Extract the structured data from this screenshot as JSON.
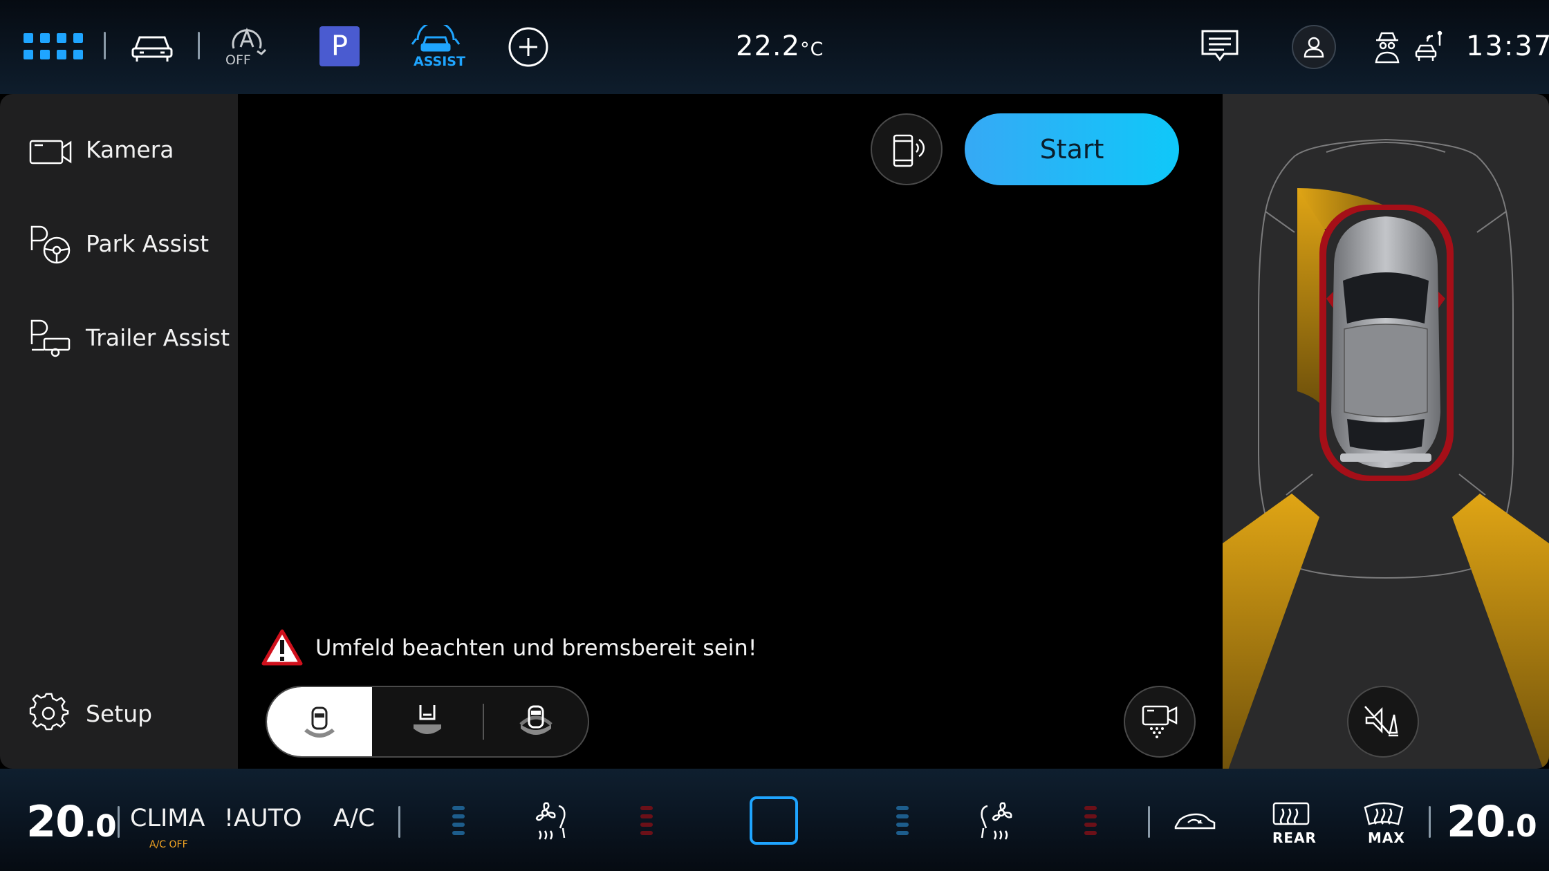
{
  "topbar": {
    "auto_hold_label": "OFF",
    "park_label": "P",
    "assist_label": "ASSIST",
    "temperature_value": "22.2",
    "temperature_unit": "°C",
    "clock": "13:37",
    "accent_color": "#1fa5ff"
  },
  "sidebar": {
    "items": [
      {
        "label": "Kamera",
        "icon": "camera-icon"
      },
      {
        "label": "Park Assist",
        "icon": "park-steering-icon"
      },
      {
        "label": "Trailer Assist",
        "icon": "park-trailer-icon"
      }
    ],
    "setup_label": "Setup"
  },
  "main": {
    "start_label": "Start",
    "warning_text": "Umfeld beachten und bremsbereit sein!",
    "view_modes": [
      "top-view-icon",
      "rear-view-icon",
      "front-view-icon"
    ],
    "selected_view": 0
  },
  "sensor_panel": {
    "warning_color_yellow": "#c9960f",
    "warning_color_red": "#b0101a"
  },
  "bottombar": {
    "left_temp_int": "20",
    "left_temp_dec": ".0",
    "clima_label": "CLIMA",
    "ac_off_label": "A/C OFF",
    "auto_label": "!AUTO",
    "ac_label": "A/C",
    "rear_label": "REAR",
    "max_label": "MAX",
    "right_temp_int": "20",
    "right_temp_dec": ".0"
  }
}
